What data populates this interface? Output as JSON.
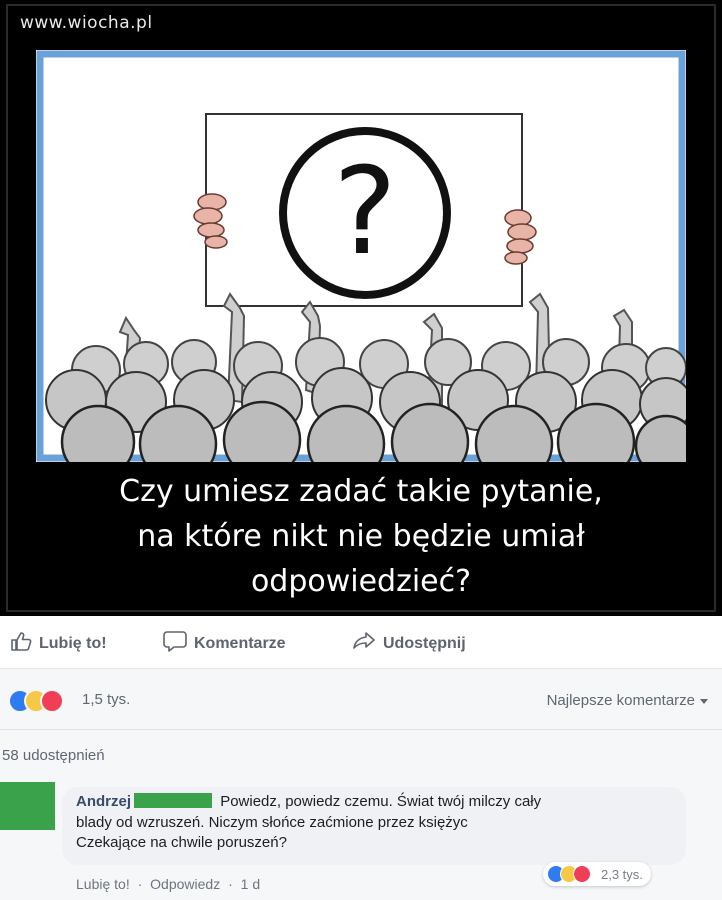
{
  "post": {
    "site": "www.wiocha.pl",
    "caption_lines": [
      "Czy umiesz zadać takie pytanie,",
      "na które nikt nie będzie umiał",
      "odpowiedzieć?"
    ],
    "sign_symbol": "?"
  },
  "actions": {
    "like": "Lubię to!",
    "comment": "Komentarze",
    "share": "Udostępnij"
  },
  "reactions": {
    "count": "1,5 tys.",
    "sort_label": "Najlepsze komentarze"
  },
  "shares": {
    "text": "58 udostępnień"
  },
  "comment": {
    "author": "Andrzej",
    "text_1": "Powiedz, powiedz czemu. Świat twój milczy cały",
    "text_2": "blady od wzruszeń. Niczym słońce zaćmione przez księżyc",
    "text_3": "Czekające na chwile poruszeń?",
    "reaction_count": "2,3 tys.",
    "like_link": "Lubię to!",
    "reply_link": "Odpowiedz",
    "time": "1 d",
    "separator": "·"
  },
  "colors": {
    "accent_blue": "#2f7bf0",
    "haha_yellow": "#f7c845",
    "love_red": "#ef3e56",
    "redaction_green": "#3aa24a"
  },
  "icons": [
    "thumbs-up-icon",
    "comment-bubble-icon",
    "share-arrow-icon",
    "like-reaction-icon",
    "haha-reaction-icon",
    "love-reaction-icon",
    "chevron-down-icon"
  ]
}
